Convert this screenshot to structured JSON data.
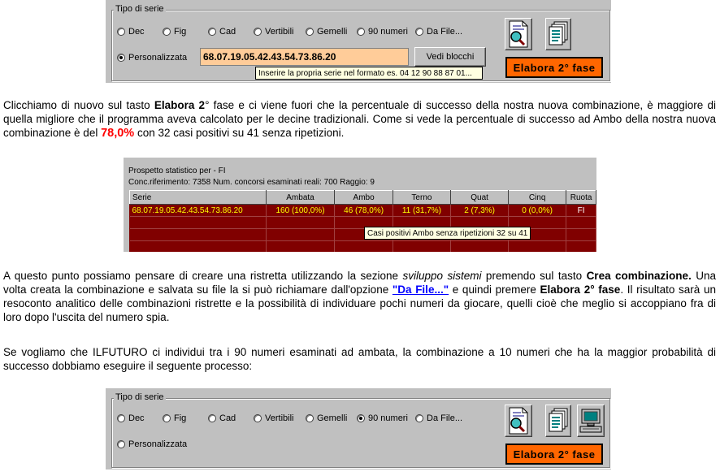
{
  "panel1": {
    "group_title": "Tipo di serie",
    "options": [
      "Dec",
      "Fig",
      "Cad",
      "Vertibili",
      "Gemelli",
      "90 numeri",
      "Da File..."
    ],
    "custom_label": "Personalizzata",
    "series_value": "68.07.19.05.42.43.54.73.86.20",
    "view_blocks_label": "Vedi blocchi",
    "elabora_label": "Elabora  2° fase",
    "tooltip": "Inserire la propria serie nel formato es. 04 12 90 88 87 01..."
  },
  "para1": {
    "t1": "Clicchiamo di nuovo sul tasto ",
    "b1": "Elabora 2",
    "t2": "° fase e ci viene fuori che la percentuale di successo della nostra nuova combinazione, è maggiore di quella migliore che il programma aveva calcolato per le decine tradizionali. Come si vede la percentuale di successo ad Ambo della nostra nuova combinazione è del ",
    "pct": "78,0%",
    "t3": " con 32 casi positivi su 41 senza ripetizioni."
  },
  "stats": {
    "title": "Prospetto statistico per  - FI",
    "info": "Conc.riferimento:  7358  Num. concorsi esaminati reali: 700   Raggio: 9",
    "headers": [
      "Serie",
      "Ambata",
      "Ambo",
      "Terno",
      "Quat",
      "Cinq",
      "Ruota"
    ],
    "row": [
      "68.07.19.05.42.43.54.73.86.20",
      "160 (100,0%)",
      "46 (78,0%)",
      "11 (31,7%)",
      "2 (7,3%)",
      "0 (0,0%)",
      "FI"
    ],
    "tooltip": "Casi positivi Ambo senza ripetizioni 32 su 41"
  },
  "para2": {
    "t1": "A questo punto possiamo pensare di creare una ristretta utilizzando la sezione ",
    "i1": "sviluppo sistemi",
    "t2": " premendo sul tasto ",
    "b1": "Crea combinazione.",
    "t3": " Una volta creata la combinazione e salvata su file la si può richiamare dall'opzione ",
    "link": "\"Da File...\"",
    "t4": " e quindi premere ",
    "b2": "Elabora 2° fase",
    "t5": ". Il risultato sarà un resoconto analitico delle combinazioni ristrette e la possibilità di individuare pochi numeri da giocare, quelli cioè che meglio si accoppiano fra di loro dopo l'uscita del numero spia."
  },
  "para3": {
    "text": "Se vogliamo che ILFUTURO ci individui tra i 90 numeri esaminati ad ambata, la combinazione a 10 numeri che ha la maggior probabilità di successo dobbiamo eseguire il seguente processo:"
  },
  "panel2": {
    "group_title": "Tipo di serie",
    "options": [
      "Dec",
      "Fig",
      "Cad",
      "Vertibili",
      "Gemelli",
      "90 numeri",
      "Da File..."
    ],
    "custom_label": "Personalizzata",
    "elabora_label": "Elabora  2° fase"
  },
  "icons": [
    "magnifier-document-icon",
    "documents-icon",
    "computer-icon"
  ]
}
